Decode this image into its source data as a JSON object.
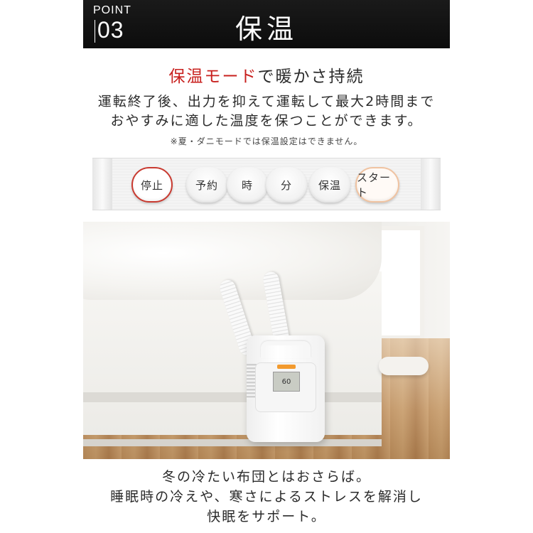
{
  "header": {
    "point_word": "POINT",
    "point_number": "03",
    "title": "保温"
  },
  "subheading": {
    "accent": "保温モード",
    "rest": "で暖かさ持続"
  },
  "description": {
    "line1": "運転終了後、出力を抑えて運転して最大2時間まで",
    "line2": "おやすみに適した温度を保つことができます。"
  },
  "note": "※夏・ダニモードでは保温設定はできません。",
  "control_panel": {
    "buttons": [
      {
        "label": "停止"
      },
      {
        "label": "予約"
      },
      {
        "label": "時"
      },
      {
        "label": "分"
      },
      {
        "label": "保温"
      },
      {
        "label": "スタート"
      }
    ]
  },
  "photo": {
    "device_display": "60"
  },
  "footer": {
    "line1": "冬の冷たい布団とはおさらば。",
    "line2": "睡眠時の冷えや、寒さによるストレスを解消し",
    "line3": "快眠をサポート。"
  },
  "colors": {
    "accent_red": "#c8201e",
    "header_bg": "#111111",
    "stop_ring": "#c93a30",
    "start_ring": "#f0c3a1"
  }
}
